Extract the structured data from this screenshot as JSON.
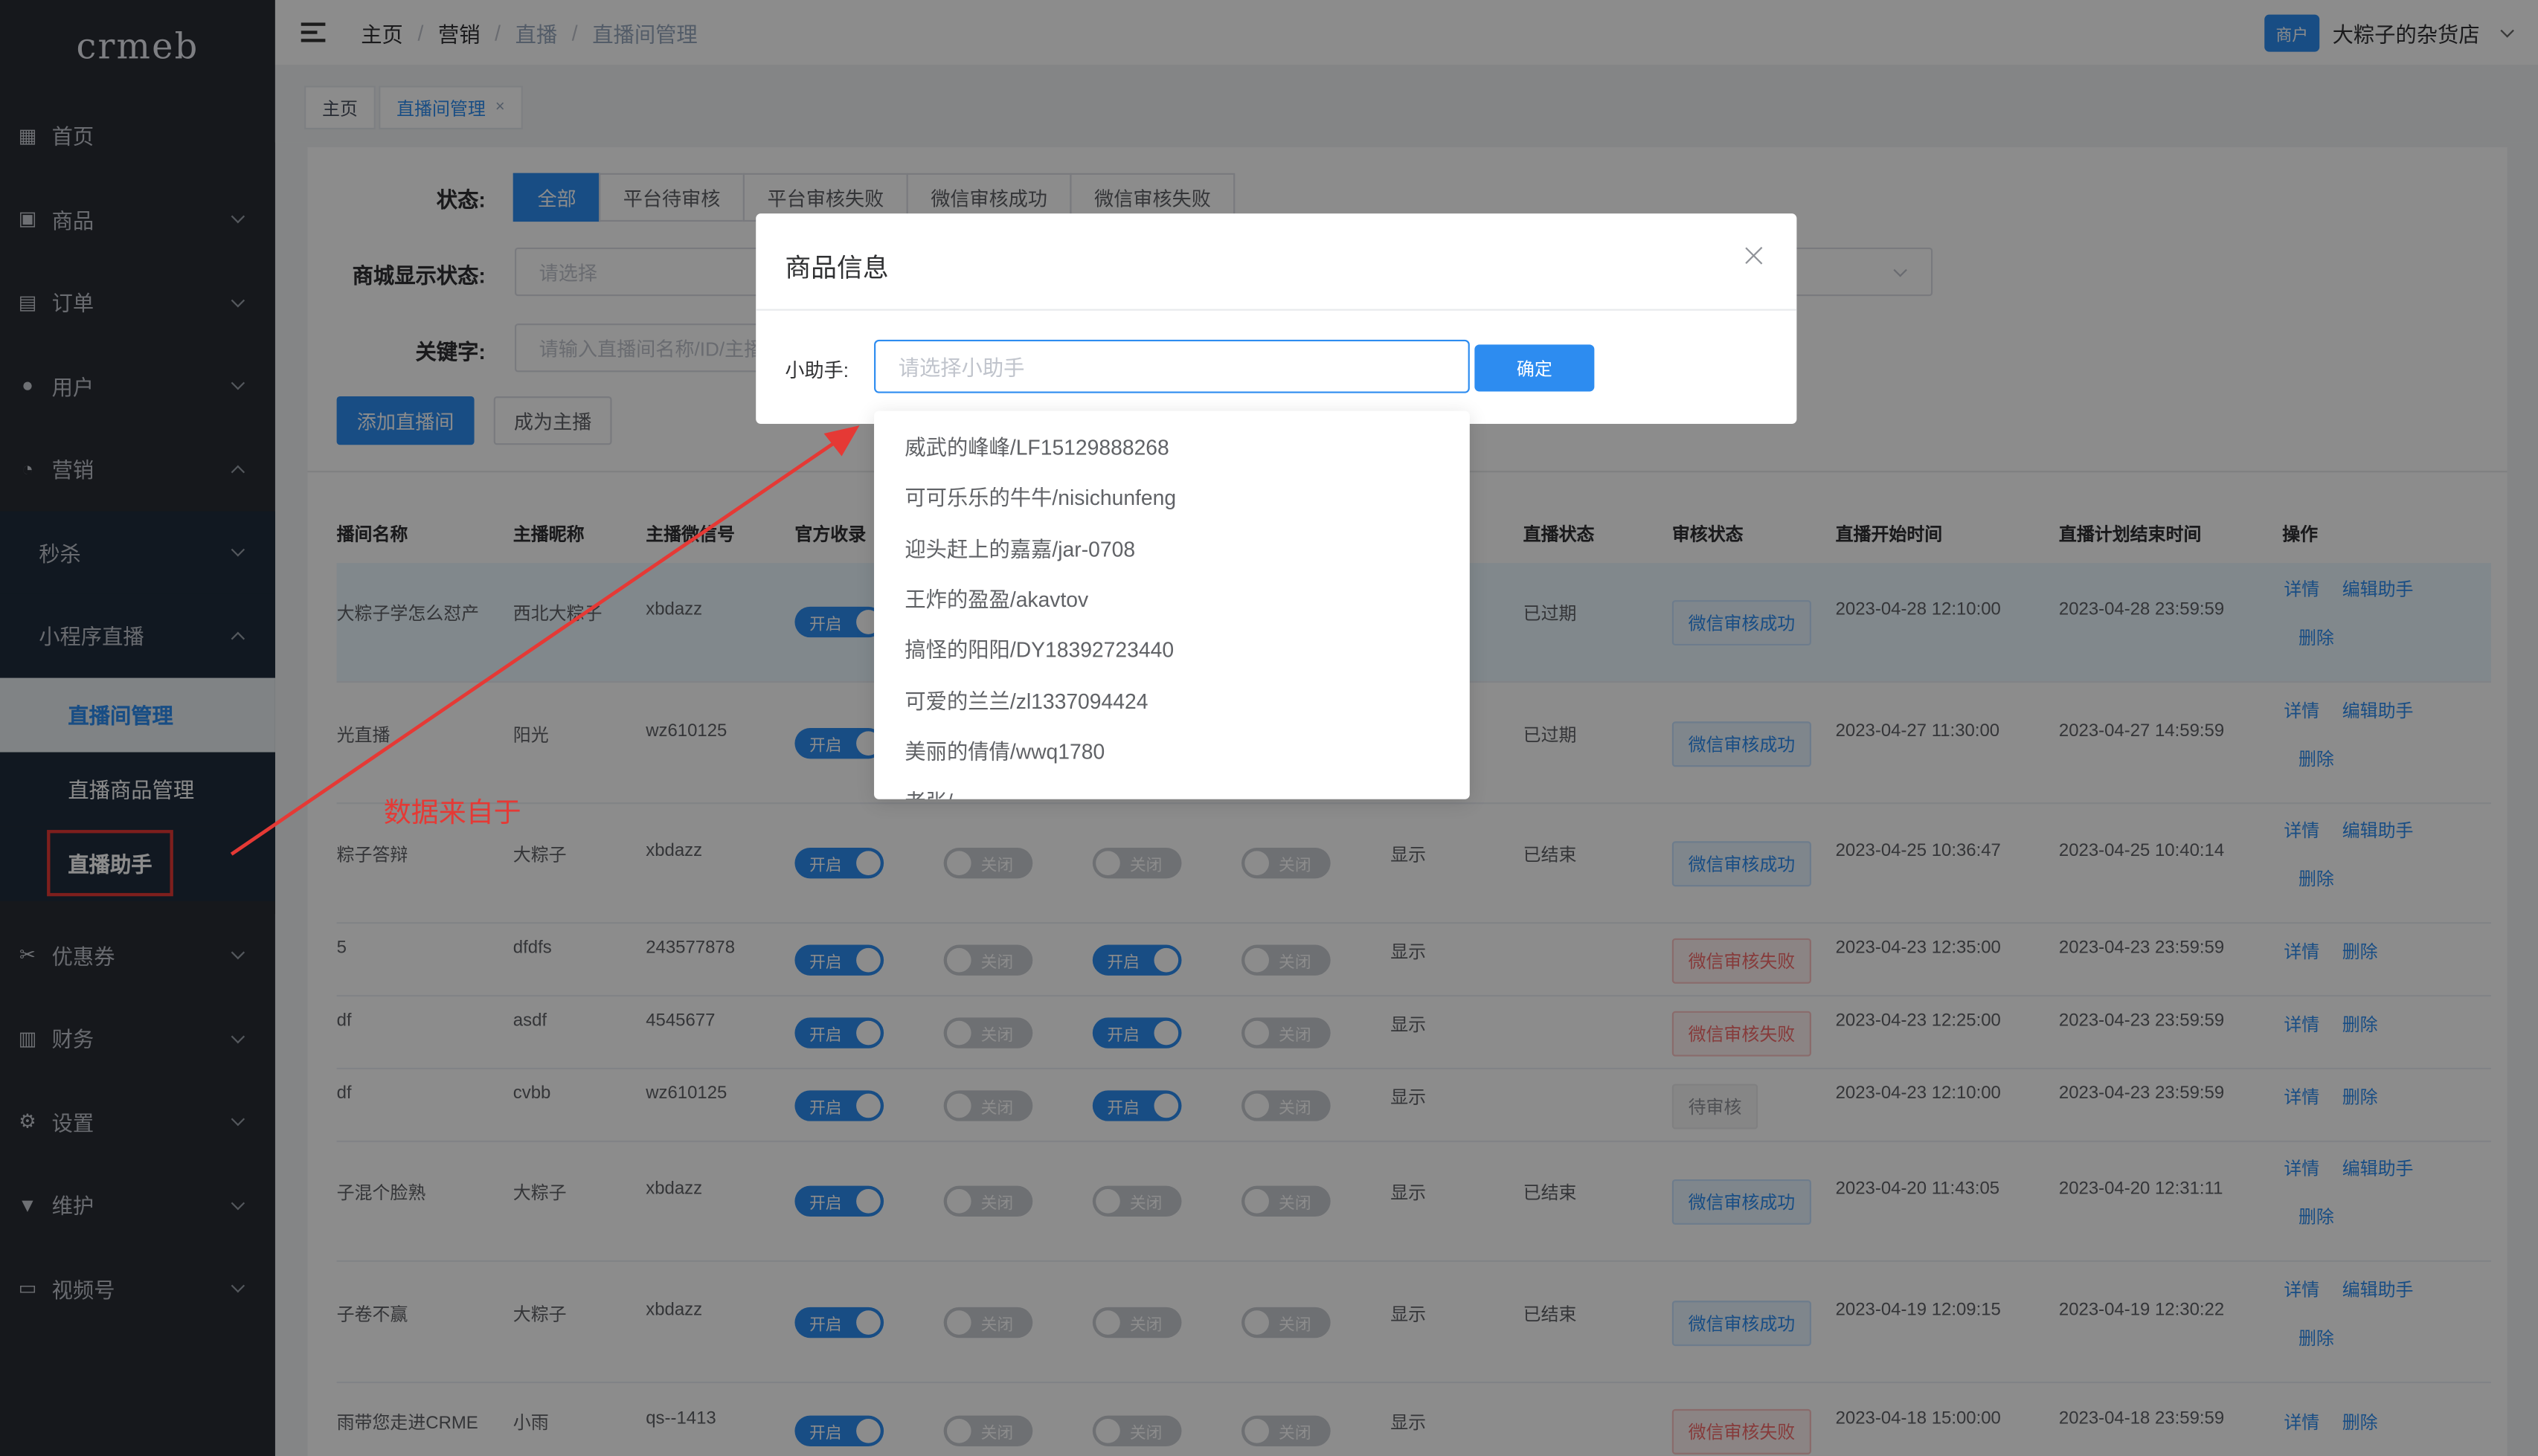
{
  "sidebar": {
    "logo": "crmeb",
    "items": [
      {
        "label": "首页",
        "icon": "grid-icon"
      },
      {
        "label": "商品",
        "icon": "bag-icon"
      },
      {
        "label": "订单",
        "icon": "clipboard-icon"
      },
      {
        "label": "用户",
        "icon": "user-icon"
      },
      {
        "label": "营销",
        "icon": "chart-icon"
      }
    ],
    "marketing_sub": {
      "seckill": "秒杀",
      "mini_live": "小程序直播"
    },
    "live_sub": [
      "直播间管理",
      "直播商品管理",
      "直播助手"
    ],
    "items_after": [
      {
        "label": "优惠券",
        "icon": "coupon-icon"
      },
      {
        "label": "财务",
        "icon": "wallet-icon"
      },
      {
        "label": "设置",
        "icon": "gear-icon"
      },
      {
        "label": "维护",
        "icon": "tool-icon"
      },
      {
        "label": "视频号",
        "icon": "video-icon"
      }
    ]
  },
  "header": {
    "breadcrumb": [
      "主页",
      "营销",
      "直播",
      "直播间管理"
    ],
    "shop_badge": "商户",
    "shop_name": "大粽子的杂货店"
  },
  "tags": {
    "home": "主页",
    "current": "直播间管理",
    "close": "×"
  },
  "filters": {
    "status_label": "状态:",
    "status_options": [
      "全部",
      "平台待审核",
      "平台审核失败",
      "微信审核成功",
      "微信审核失败"
    ],
    "display_label": "商城显示状态:",
    "display_placeholder": "请选择",
    "keyword_label": "关键字:",
    "keyword_placeholder": "请输入直播间名称/ID/主播"
  },
  "actions": {
    "add": "添加直播间",
    "become_host": "成为主播"
  },
  "table": {
    "headers": [
      "播间名称",
      "主播昵称",
      "主播微信号",
      "官方收录",
      "直播状态",
      "审核状态",
      "直播开始时间",
      "直播计划结束时间",
      "操作"
    ],
    "switch_on": "开启",
    "switch_off": "关闭",
    "rows": [
      {
        "name": "大粽子学怎么怼产",
        "host": "西北大粽子",
        "wechat": "xbdazz",
        "show": "",
        "live": "已过期",
        "audit": "微信审核成功",
        "start": "2023-04-28 12:10:00",
        "end": "2023-04-28 23:59:59",
        "ops": [
          "详情",
          "编辑助手",
          "删除"
        ]
      },
      {
        "name": "光直播",
        "host": "阳光",
        "wechat": "wz610125",
        "show": "",
        "live": "已过期",
        "audit": "微信审核成功",
        "start": "2023-04-27 11:30:00",
        "end": "2023-04-27 14:59:59",
        "ops": [
          "详情",
          "编辑助手",
          "删除"
        ]
      },
      {
        "name": "粽子答辩",
        "host": "大粽子",
        "wechat": "xbdazz",
        "show": "显示",
        "live": "已结束",
        "audit": "微信审核成功",
        "start": "2023-04-25 10:36:47",
        "end": "2023-04-25 10:40:14",
        "ops": [
          "详情",
          "编辑助手",
          "删除"
        ]
      },
      {
        "name": "5",
        "host": "dfdfs",
        "wechat": "243577878",
        "show": "显示",
        "live": "",
        "audit": "微信审核失败",
        "start": "2023-04-23 12:35:00",
        "end": "2023-04-23 23:59:59",
        "ops": [
          "详情",
          "删除"
        ]
      },
      {
        "name": "df",
        "host": "asdf",
        "wechat": "4545677",
        "show": "显示",
        "live": "",
        "audit": "微信审核失败",
        "start": "2023-04-23 12:25:00",
        "end": "2023-04-23 23:59:59",
        "ops": [
          "详情",
          "删除"
        ]
      },
      {
        "name": "df",
        "host": "cvbb",
        "wechat": "wz610125",
        "show": "显示",
        "live": "",
        "audit": "待审核",
        "start": "2023-04-23 12:10:00",
        "end": "2023-04-23 23:59:59",
        "ops": [
          "详情",
          "删除"
        ]
      },
      {
        "name": "子混个脸熟",
        "host": "大粽子",
        "wechat": "xbdazz",
        "show": "显示",
        "live": "已结束",
        "audit": "微信审核成功",
        "start": "2023-04-20 11:43:05",
        "end": "2023-04-20 12:31:11",
        "ops": [
          "详情",
          "编辑助手",
          "删除"
        ]
      },
      {
        "name": "子卷不赢",
        "host": "大粽子",
        "wechat": "xbdazz",
        "show": "显示",
        "live": "已结束",
        "audit": "微信审核成功",
        "start": "2023-04-19 12:09:15",
        "end": "2023-04-19 12:30:22",
        "ops": [
          "详情",
          "编辑助手",
          "删除"
        ]
      },
      {
        "name": "雨带您走进CRME",
        "host": "小雨",
        "wechat": "qs--1413",
        "show": "显示",
        "live": "",
        "audit": "微信审核失败",
        "start": "2023-04-18 15:00:00",
        "end": "2023-04-18 23:59:59",
        "ops": [
          "详情",
          "删除"
        ]
      }
    ]
  },
  "modal": {
    "title": "商品信息",
    "label": "小助手:",
    "placeholder": "请选择小助手",
    "confirm": "确定",
    "options": [
      "威武的峰峰/LF15129888268",
      "可可乐乐的牛牛/nisichunfeng",
      "迎头赶上的嘉嘉/jar-0708",
      "王炸的盈盈/akavtov",
      "搞怪的阳阳/DY18392723440",
      "可爱的兰兰/zl1337094424",
      "美丽的倩倩/wwq1780",
      "老张/..."
    ]
  },
  "annotation": {
    "text": "数据来自于",
    "color": "#e53935"
  },
  "colors": {
    "primary": "#2d8cf0",
    "sidebar": "#282c34",
    "danger": "#f56c6c"
  }
}
